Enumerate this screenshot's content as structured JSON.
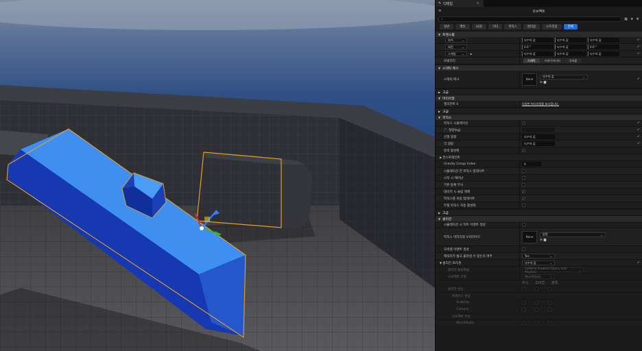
{
  "tab": {
    "label": "디테일",
    "close": "×"
  },
  "panel_title": "오브젝트",
  "search": {
    "placeholder": ""
  },
  "filters": [
    {
      "label": "일반",
      "active": false
    },
    {
      "label": "액터",
      "active": false
    },
    {
      "label": "LOD",
      "active": false
    },
    {
      "label": "기타",
      "active": false
    },
    {
      "label": "피직스",
      "active": false
    },
    {
      "label": "렌더링",
      "active": false
    },
    {
      "label": "스트리밍",
      "active": false
    },
    {
      "label": "전체",
      "active": true
    }
  ],
  "sections": {
    "transform": "트랜스폼",
    "static_mesh": "스태틱 메시",
    "advanced": "고급",
    "material": "머티리얼",
    "physics": "피직스",
    "collision": "콜리전"
  },
  "transform": {
    "location_label": "위치",
    "rotation_label": "회전",
    "scale_label": "스케일",
    "mobility_label": "모빌리티",
    "location": [
      "다수의 값",
      "다수의 값",
      "다수의 값"
    ],
    "rotation": [
      "0.0 °",
      "다수의 값",
      "0.0 °"
    ],
    "scale": [
      "다수의 값",
      "다수의 값",
      "다수의 값"
    ],
    "mobility": [
      "스태틱",
      "스테이셔너리",
      "무버블"
    ]
  },
  "static_mesh": {
    "label": "스태틱 메시",
    "value": "다수의 값",
    "thumb": "None"
  },
  "material": {
    "label": "엘리먼트 0",
    "link": "다양한 머티리얼을 표시합니다."
  },
  "physics": {
    "simulate_label": "피직스 시뮬레이션",
    "mass_label": "질량(kg)",
    "linear_damping_label": "선형 댐핑",
    "angular_damping_label": "각 댐핑",
    "linear_damping": "다수의 값",
    "angular_damping": "다수의 값",
    "gravity_label": "중력 활성화",
    "constraints_label": "컨스트레인트",
    "gravity_group_label": "Gravity Group Index",
    "gravity_group_value": "0",
    "rows": [
      "시뮬레이션 전 피직스 업데이트",
      "시작 시 깨어남",
      "기본 동체 무시",
      "대미지 시 슬립 해제",
      "피직스를 자동 업데이트",
      "부품 피직스 자동 활성화"
    ]
  },
  "collision": {
    "sim_hit_label": "시뮬레이션 시 히트 이벤트 생성",
    "phys_mat_label": "피직스 머티리얼 오버라이드",
    "phys_mat_value": "없음",
    "phys_mat_thumb": "None",
    "overlap_label": "오버랩 이벤트 생성",
    "step_label": "캐릭터가 밟고 올라설 수 있는지 여부",
    "step_value": "Yes",
    "presets_label": "콜리전 프리셋",
    "presets_value": "다수의 값",
    "enabled_label": "콜리전 활성화됨",
    "enabled_value": "Collision Enabled (Query and Physics)",
    "objtype_label": "오브젝트 유형",
    "objtype_value": "WorldStatic",
    "col_headers": [
      "무시",
      "오버랩",
      "블록"
    ],
    "responses_label": "콜리전 반응",
    "trace_label": "트레이스 반응",
    "visibility_label": "Visibility",
    "camera_label": "Camera",
    "objresp_label": "오브젝트 반응",
    "worldstatic_label": "WorldStatic"
  },
  "colors": {
    "accent": "#1b6fe0",
    "mesh_blue": "#2f7fe0",
    "selection": "#e8a020"
  }
}
